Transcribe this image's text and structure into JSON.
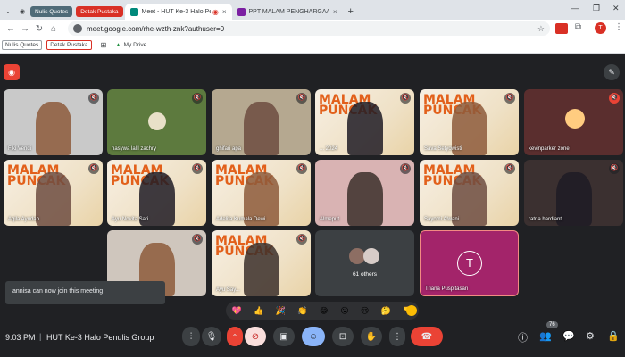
{
  "tabs": [
    {
      "label": "Nulis Quotes",
      "type": "pill"
    },
    {
      "label": "Detak Pustaka",
      "type": "pill-red"
    },
    {
      "label": "Meet - HUT Ke-3 Halo Penulis",
      "type": "active"
    },
    {
      "label": "PPT MALAM PENGHARGAAN",
      "type": "normal"
    }
  ],
  "browser": {
    "url": "meet.google.com/rhe-wzth-znk?authuser=0",
    "bookmarks": [
      "Nulis Quotes",
      "Detak Pustaka",
      "My Drive"
    ]
  },
  "tiles": [
    {
      "name": "Fiki Vendi",
      "bg": "#c9c9c9",
      "banner": false
    },
    {
      "name": "nasywa lalil zachry",
      "bg": "#5d7a3e",
      "banner": false
    },
    {
      "name": "ghifari apa",
      "bg": "#b5a890",
      "banner": false
    },
    {
      "name": "... 2024",
      "bg": "",
      "banner": true
    },
    {
      "name": "Sava Setyowisti",
      "bg": "",
      "banner": true
    },
    {
      "name": "kevinparker zone",
      "bg": "#5a2e2e",
      "banner": false
    },
    {
      "name": "Aqila Ayudah",
      "bg": "",
      "banner": true
    },
    {
      "name": "Ayu Novita Sari",
      "bg": "",
      "banner": true
    },
    {
      "name": "Adelita Kumala Dewi",
      "bg": "",
      "banner": true
    },
    {
      "name": "Almeput",
      "bg": "#d9b3b3",
      "banner": false
    },
    {
      "name": "Sayomi Alwani",
      "bg": "",
      "banner": true
    },
    {
      "name": "ratna hardianti",
      "bg": "#3b3030",
      "banner": false
    },
    {
      "name": "...di",
      "bg": "#cfc6bd",
      "banner": false
    },
    {
      "name": "Ayu Say...",
      "bg": "",
      "banner": true
    },
    {
      "name": "61 others",
      "bg": "#3c4043",
      "banner": false
    },
    {
      "name": "Triana Puspitasari",
      "bg": "#a3246a",
      "banner": false
    }
  ],
  "banner_text": "MALAM PUNCAK",
  "toast": "annisa can now join this meeting",
  "meeting": {
    "time": "9:03 PM",
    "title": "HUT Ke-3 Halo Penulis Group"
  },
  "participant_count": "76",
  "reactions": [
    "💖",
    "👍",
    "🎉",
    "👏",
    "😂",
    "😮",
    "😢",
    "🤔",
    "👎"
  ],
  "triana_initial": "T",
  "avatar_initial": "T"
}
